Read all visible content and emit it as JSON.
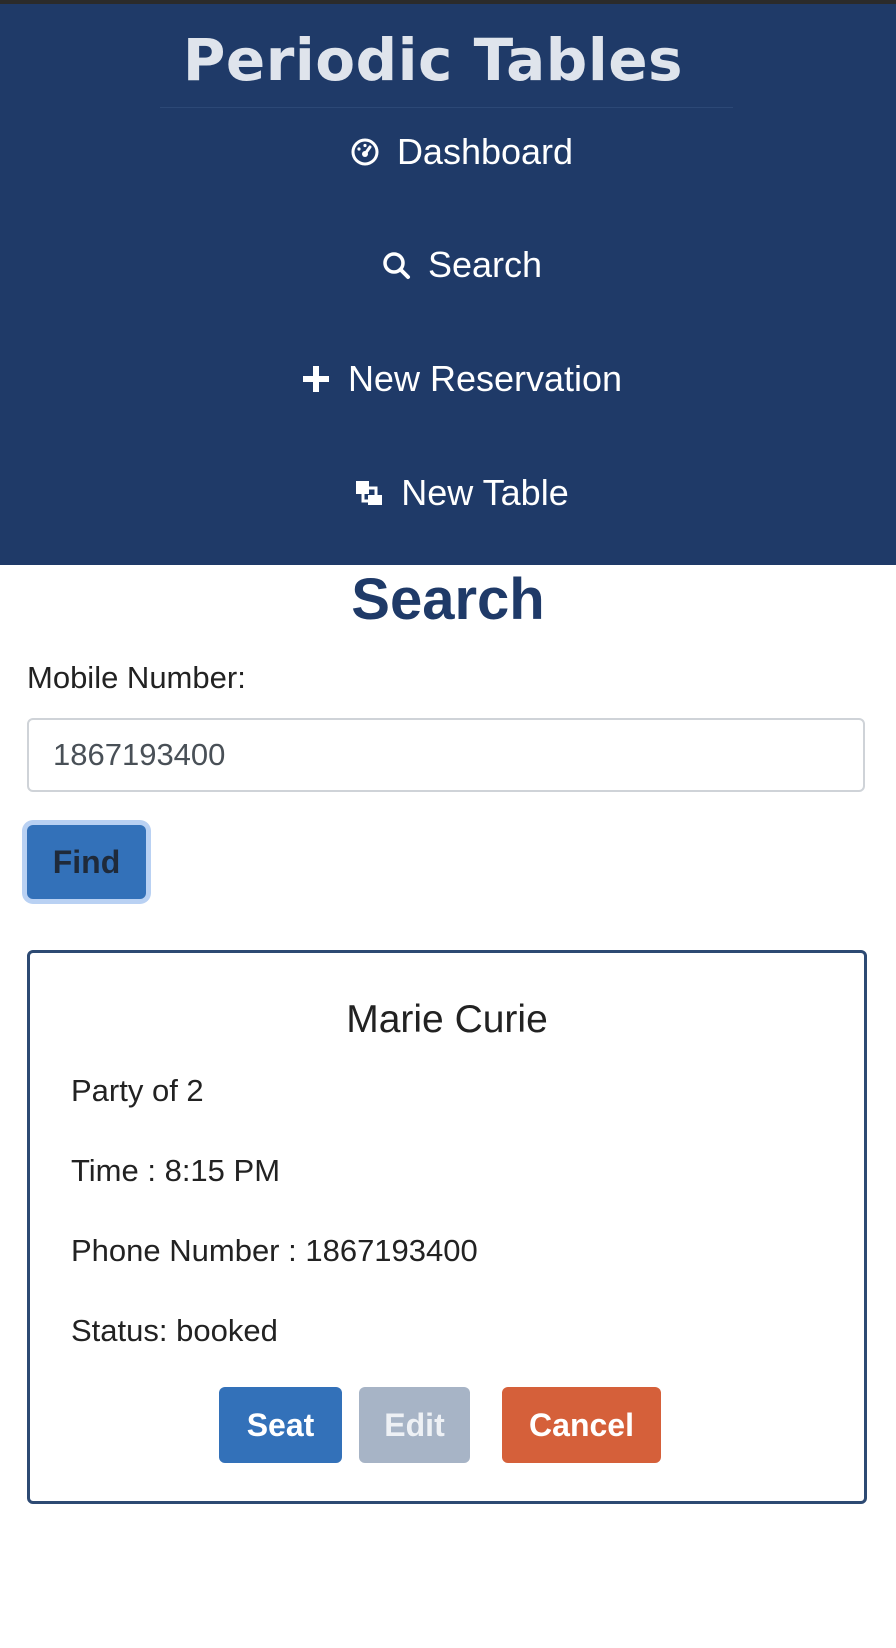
{
  "sidebar": {
    "brand": "Periodic Tables",
    "items": [
      {
        "label": "Dashboard",
        "icon": "dashboard-icon"
      },
      {
        "label": "Search",
        "icon": "search-icon"
      },
      {
        "label": "New Reservation",
        "icon": "plus-icon"
      },
      {
        "label": "New Table",
        "icon": "new-table-icon"
      }
    ]
  },
  "main": {
    "title": "Search",
    "mobile_label": "Mobile Number:",
    "mobile_value": "1867193400",
    "find_label": "Find"
  },
  "reservation": {
    "name": "Marie Curie",
    "party": "Party of 2",
    "time": "Time : 8:15 PM",
    "phone": "Phone Number : 1867193400",
    "status": "Status: booked",
    "seat_label": "Seat",
    "edit_label": "Edit",
    "cancel_label": "Cancel"
  },
  "colors": {
    "sidebar_bg": "#1f3a68",
    "primary": "#3371b9",
    "secondary": "#a7b4c6",
    "danger": "#d5603a",
    "title": "#1f3a68"
  }
}
